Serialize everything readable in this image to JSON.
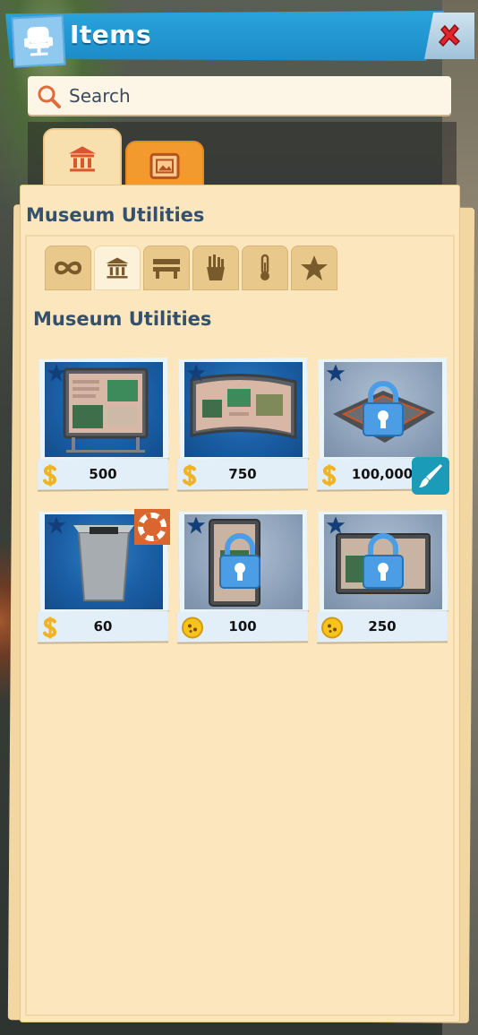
{
  "window": {
    "title": "Items",
    "title_icon": "chair-icon",
    "close_icon": "close-x-icon"
  },
  "search": {
    "placeholder": "Search",
    "value": ""
  },
  "category_tabs": [
    {
      "name": "museum",
      "icon": "museum-icon",
      "active": true
    },
    {
      "name": "framed-picture",
      "icon": "picture-frame-icon",
      "active": false
    }
  ],
  "section_title": "Museum Utilities",
  "sub_tabs": [
    {
      "icon": "infinity-icon",
      "active": false
    },
    {
      "icon": "museum-icon",
      "active": true
    },
    {
      "icon": "bench-icon",
      "active": false
    },
    {
      "icon": "fries-icon",
      "active": false
    },
    {
      "icon": "thermometer-icon",
      "active": false
    },
    {
      "icon": "star-icon",
      "active": false
    }
  ],
  "subsection_title": "Museum Utilities",
  "items": [
    {
      "price": "500",
      "currency": "money",
      "locked": false,
      "favorite": true,
      "badge": null
    },
    {
      "price": "750",
      "currency": "money",
      "locked": false,
      "favorite": true,
      "badge": null
    },
    {
      "price": "100,000",
      "currency": "money",
      "locked": true,
      "favorite": true,
      "badge": "paintbrush"
    },
    {
      "price": "60",
      "currency": "money",
      "locked": false,
      "favorite": true,
      "badge": "lifebuoy"
    },
    {
      "price": "100",
      "currency": "token",
      "locked": true,
      "favorite": true,
      "badge": null
    },
    {
      "price": "250",
      "currency": "token",
      "locked": true,
      "favorite": true,
      "badge": null
    }
  ],
  "colors": {
    "title_bar": "#1c8cc8",
    "panel": "#fbe6bd",
    "text_heading": "#35506b",
    "accent_orange": "#f39a2f",
    "money_gold": "#f0b323"
  }
}
